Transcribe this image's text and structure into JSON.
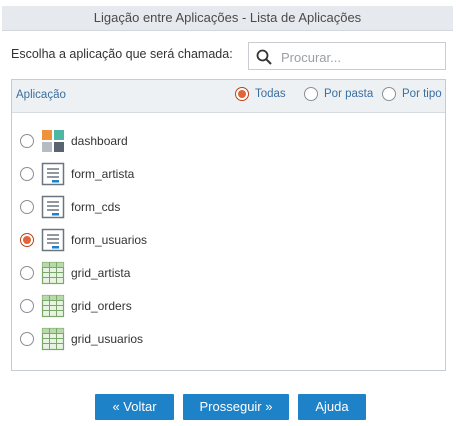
{
  "window": {
    "title": "Ligação entre Aplicações - Lista de Aplicações"
  },
  "search": {
    "label": "Escolha a aplicação que será chamada:",
    "placeholder": "Procurar...",
    "value": ""
  },
  "table": {
    "column": "Aplicação",
    "filters": [
      {
        "label": "Todas",
        "selected": true
      },
      {
        "label": "Por pasta",
        "selected": false
      },
      {
        "label": "Por tipo",
        "selected": false
      }
    ],
    "items": [
      {
        "name": "dashboard",
        "icon": "dashboard-icon",
        "selected": false
      },
      {
        "name": "form_artista",
        "icon": "form-icon",
        "selected": false
      },
      {
        "name": "form_cds",
        "icon": "form-icon",
        "selected": false
      },
      {
        "name": "form_usuarios",
        "icon": "form-icon",
        "selected": true
      },
      {
        "name": "grid_artista",
        "icon": "grid-icon",
        "selected": false
      },
      {
        "name": "grid_orders",
        "icon": "grid-icon",
        "selected": false
      },
      {
        "name": "grid_usuarios",
        "icon": "grid-icon",
        "selected": false
      }
    ]
  },
  "buttons": {
    "back": "« Voltar",
    "next": "Prosseguir »",
    "help": "Ajuda"
  },
  "colors": {
    "accent": "#1e82c8",
    "radio_selected": "#e0663a",
    "header_text": "#3b6fa0"
  }
}
